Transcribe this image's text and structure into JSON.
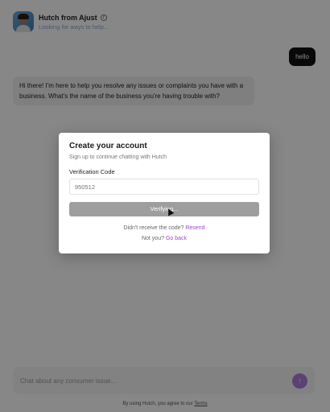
{
  "header": {
    "name": "Hutch from Ajust",
    "status": "Looking for ways to help..."
  },
  "messages": {
    "user": "hello",
    "bot": "Hi there! I'm here to help you resolve any issues or complaints you have with a business. What's the name of the business you're having trouble with?"
  },
  "composer": {
    "placeholder": "Chat about any consumer issue...",
    "send_icon": "arrow-up-icon"
  },
  "footer": {
    "prefix": "By using Hutch, you agree to our ",
    "terms_label": "Terms"
  },
  "modal": {
    "title": "Create your account",
    "subtitle": "Sign up to continue chatting with Hutch",
    "field_label": "Verification Code",
    "code_placeholder": "950512",
    "button_label": "Verifying...",
    "resend_prefix": "Didn't receive the code? ",
    "resend_link": "Resend",
    "notyou_prefix": "Not you? ",
    "goback_link": "Go back"
  },
  "colors": {
    "accent": "#a046d8",
    "send_button": "#b07bd8",
    "user_bubble": "#111111"
  }
}
